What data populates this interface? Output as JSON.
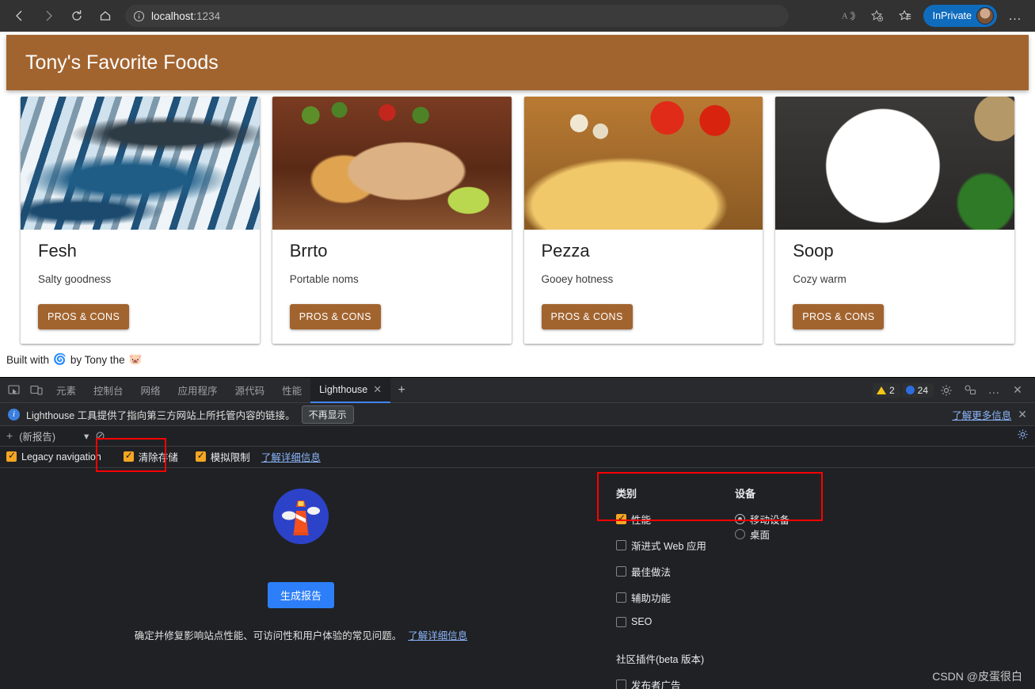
{
  "browser": {
    "back_label": "back-arrow",
    "forward_label": "forward-arrow",
    "reload_label": "reload",
    "home_label": "home",
    "url_host": "localhost",
    "url_port": ":1234",
    "inprivate_label": "InPrivate",
    "more_label": "…"
  },
  "page": {
    "title": "Tony's Favorite Foods",
    "cards": [
      {
        "title": "Fesh",
        "subtitle": "Salty goodness",
        "button": "PROS & CONS",
        "photo": "fish-photo"
      },
      {
        "title": "Brrto",
        "subtitle": "Portable noms",
        "button": "PROS & CONS",
        "photo": "burrito-photo"
      },
      {
        "title": "Pezza",
        "subtitle": "Gooey hotness",
        "button": "PROS & CONS",
        "photo": "pizza-photo"
      },
      {
        "title": "Soop",
        "subtitle": "Cozy warm",
        "button": "PROS & CONS",
        "photo": "soup-photo"
      }
    ],
    "footer_prefix": "Built with",
    "footer_emoji1": "🌀",
    "footer_middle": "by Tony the",
    "footer_emoji2": "🐷",
    "header_color": "#a2642f"
  },
  "devtools": {
    "tabs": [
      {
        "label": "元素",
        "active": false
      },
      {
        "label": "控制台",
        "active": false
      },
      {
        "label": "网络",
        "active": false
      },
      {
        "label": "应用程序",
        "active": false
      },
      {
        "label": "源代码",
        "active": false
      },
      {
        "label": "性能",
        "active": false
      },
      {
        "label": "Lighthouse",
        "active": true
      }
    ],
    "tab_close": "✕",
    "tab_add": "+",
    "warning_count": "2",
    "info_count": "24",
    "more_label": "…",
    "close_label": "✕",
    "banner": {
      "text": "Lighthouse 工具提供了指向第三方网站上所托管内容的链接。",
      "dismiss": "不再显示",
      "link": "了解更多信息",
      "close": "✕"
    },
    "report_toolbar": {
      "add": "+",
      "select_value": "(新报告)",
      "caret": "▾",
      "clear": "⊘"
    },
    "options": {
      "legacy_navigation": "Legacy navigation",
      "clear_storage": "清除存储",
      "simulated_throttling": "模拟限制",
      "learn_more": "了解详细信息"
    },
    "start": {
      "generate_button": "生成报告",
      "description": "确定并修复影响站点性能、可访问性和用户体验的常见问题。",
      "description_link": "了解详细信息"
    },
    "categories": {
      "category_header": "类别",
      "device_header": "设备",
      "items": [
        {
          "label": "性能",
          "checked": true
        },
        {
          "label": "渐进式 Web 应用",
          "checked": false
        },
        {
          "label": "最佳做法",
          "checked": false
        },
        {
          "label": "辅助功能",
          "checked": false
        },
        {
          "label": "SEO",
          "checked": false
        }
      ],
      "devices": [
        {
          "label": "移动设备",
          "selected": true
        },
        {
          "label": "桌面",
          "selected": false
        }
      ],
      "plugins_header": "社区插件(beta 版本)",
      "plugins": [
        {
          "label": "发布者广告",
          "checked": false
        }
      ]
    }
  },
  "watermark": "CSDN @皮蛋很白"
}
